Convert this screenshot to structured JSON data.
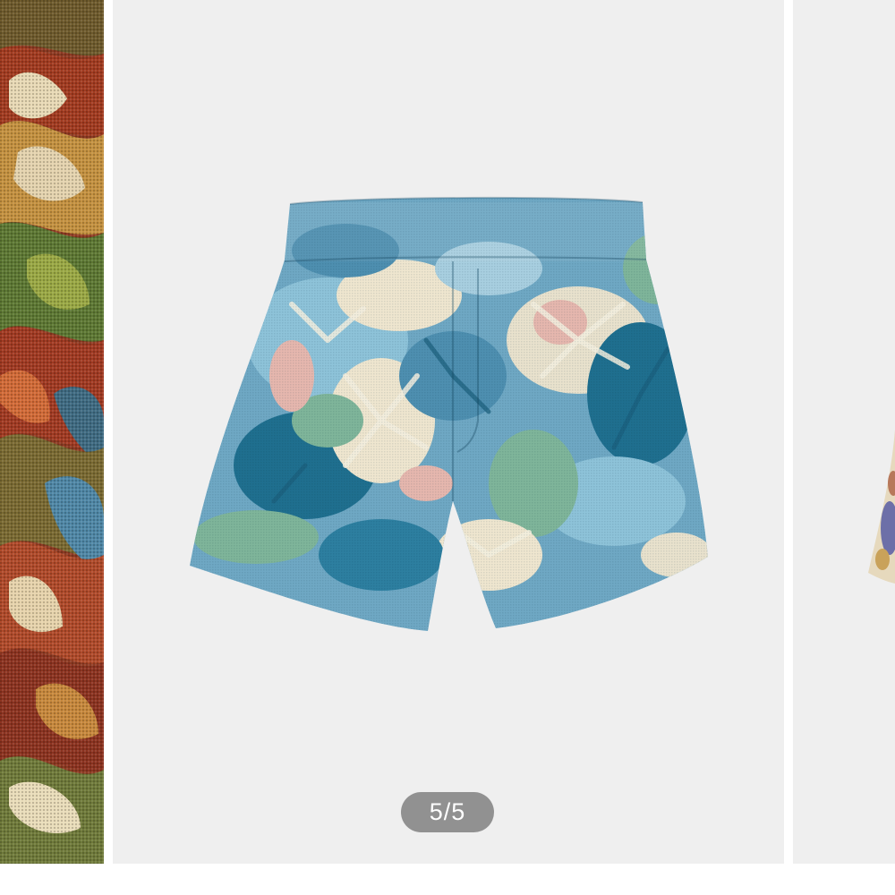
{
  "gallery": {
    "counter_text": "5/5",
    "current_index": 5,
    "total": 5,
    "background_color": "#efefef"
  },
  "slides": {
    "prev": {
      "name": "tapestry-fabric-closeup"
    },
    "current": {
      "name": "blue-floral-jacquard-shorts"
    },
    "next": {
      "name": "beige-tapestry-shorts"
    }
  },
  "colors": {
    "shorts_base": "#6fa8c4",
    "shorts_dark": "#1f6f8f",
    "shorts_cream": "#efe6cf",
    "shorts_pink": "#e6b7ae",
    "shorts_green": "#7fb59a",
    "tapestry_red": "#a83a22",
    "tapestry_gold": "#c99a45",
    "tapestry_cream": "#eadcbc",
    "tapestry_green": "#5f7a35"
  }
}
